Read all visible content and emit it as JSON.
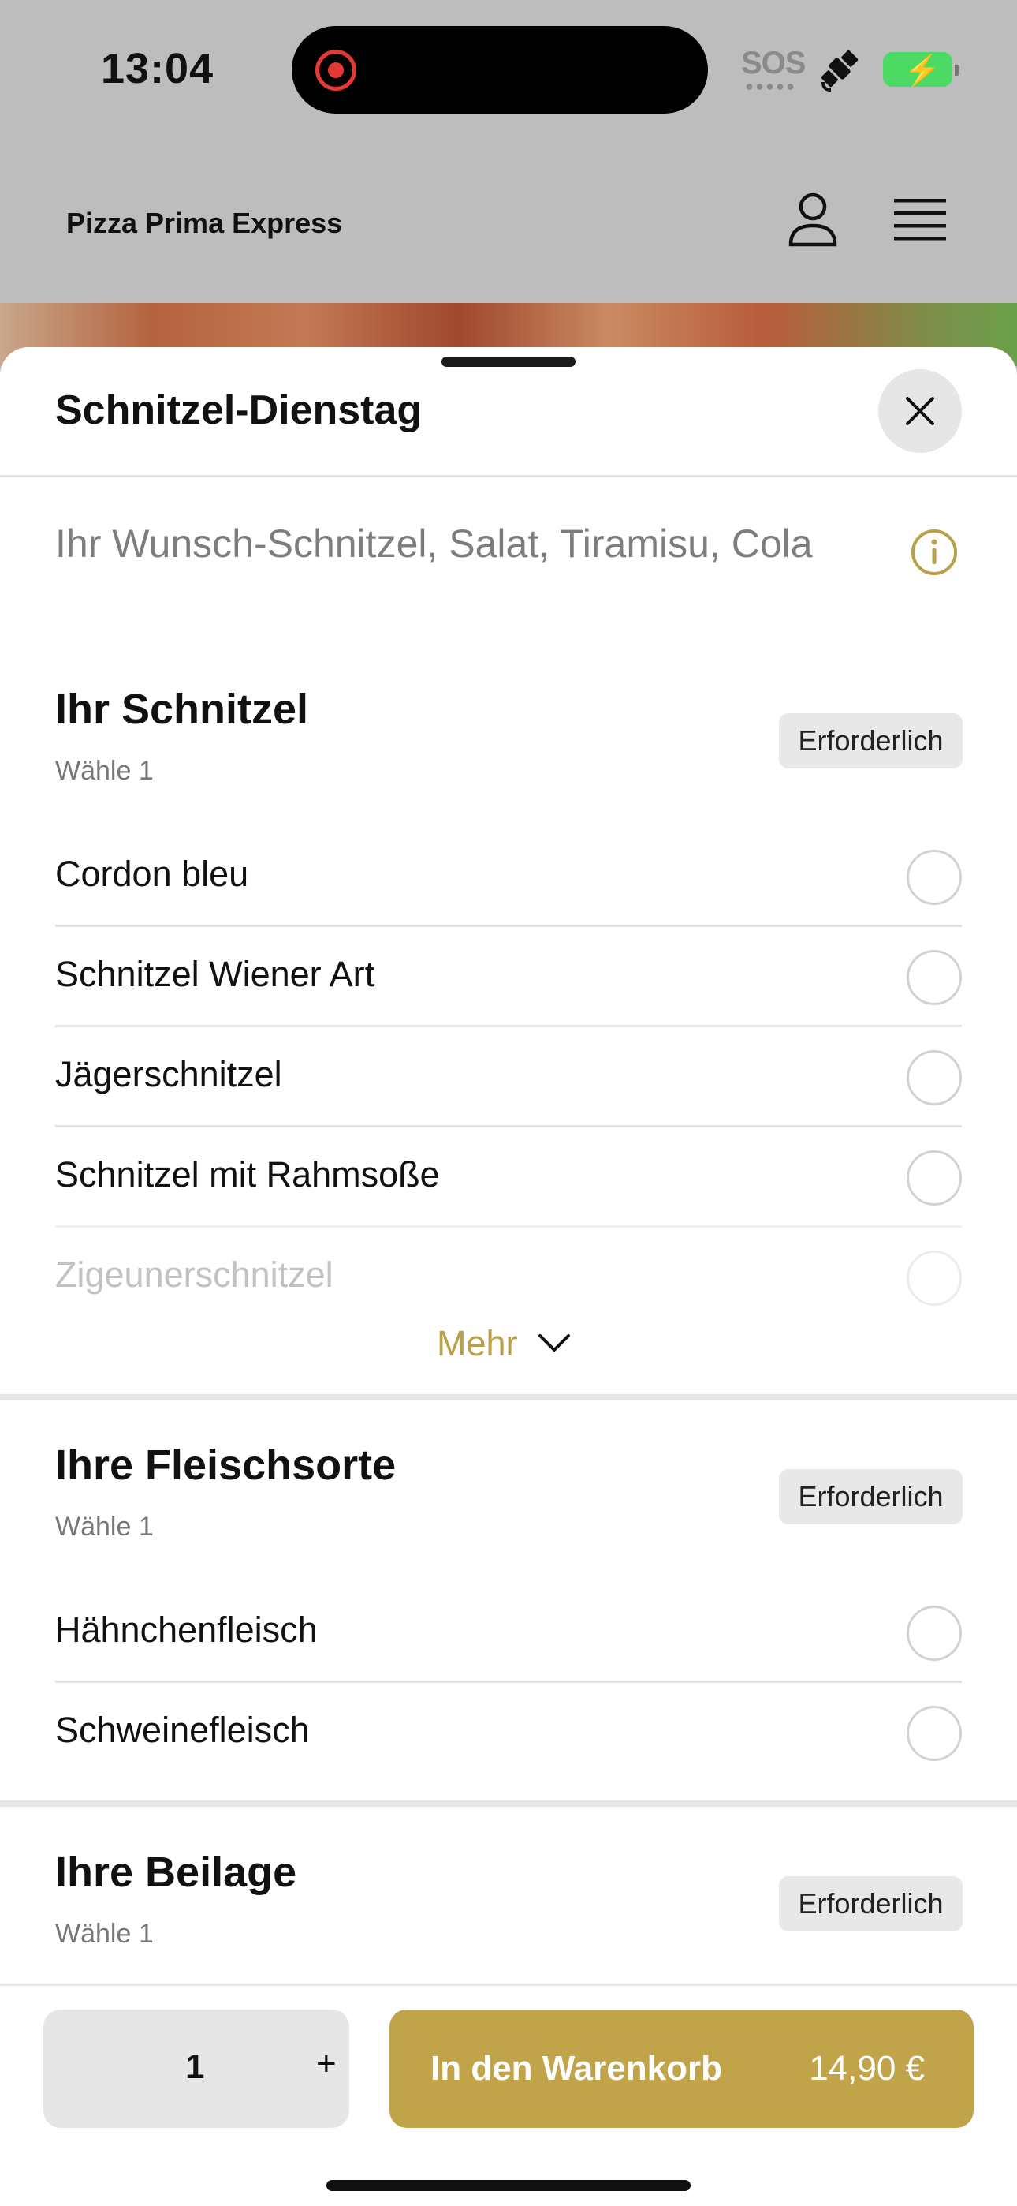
{
  "status_bar": {
    "time": "13:04",
    "sos_label": "SOS",
    "icons": [
      "screen-recording-icon",
      "satellite-icon",
      "battery-charging-icon"
    ]
  },
  "header": {
    "brand": "Pizza Prima Express",
    "icons": [
      "user-icon",
      "menu-icon"
    ]
  },
  "sheet": {
    "title": "Schnitzel-Dienstag",
    "description": "Ihr Wunsch-Schnitzel, Salat, Tiramisu, Cola",
    "sections": [
      {
        "title": "Ihr Schnitzel",
        "subtitle": "Wähle 1",
        "badge": "Erforderlich",
        "options": [
          "Cordon bleu",
          "Schnitzel Wiener Art",
          "Jägerschnitzel",
          "Schnitzel mit Rahmsoße",
          "Zigeunerschnitzel"
        ],
        "more_label": "Mehr"
      },
      {
        "title": "Ihre Fleischsorte",
        "subtitle": "Wähle 1",
        "badge": "Erforderlich",
        "options": [
          "Hähnchenfleisch",
          "Schweinefleisch"
        ]
      },
      {
        "title": "Ihre Beilage",
        "subtitle": "Wähle 1",
        "badge": "Erforderlich"
      }
    ]
  },
  "bottom_bar": {
    "quantity": "1",
    "plus_label": "+",
    "cart_label": "In den Warenkorb",
    "price": "14,90 €"
  },
  "colors": {
    "accent": "#c1a44a",
    "link": "#b9a04a",
    "overlay": "#bdbdbd"
  }
}
